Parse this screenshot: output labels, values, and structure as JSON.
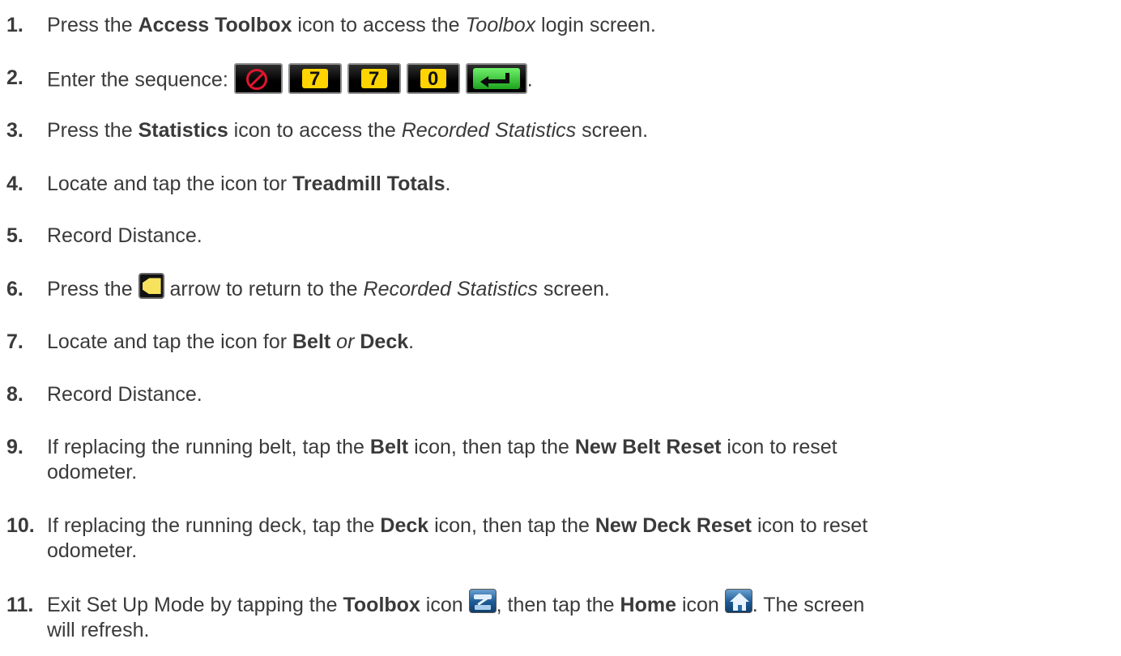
{
  "steps": [
    {
      "n": "1.",
      "t1": "Press the ",
      "b1": "Access Toolbox",
      "t2": " icon to access the ",
      "i1": "Toolbox",
      "t3": " login screen."
    },
    {
      "n": "2.",
      "t1": "Enter the sequence: ",
      "keys": {
        "cancel_icon": "cancel-icon",
        "d1": "7",
        "d2": "7",
        "d3": "0",
        "enter_icon": "enter-arrow-icon"
      },
      "t2": "."
    },
    {
      "n": "3.",
      "t1": "Press the ",
      "b1": "Statistics",
      "t2": " icon to access the ",
      "i1": "Recorded Statistics",
      "t3": " screen."
    },
    {
      "n": "4.",
      "t1": "Locate and tap the icon tor ",
      "b1": "Treadmill Totals",
      "t2": "."
    },
    {
      "n": "5.",
      "t1": "Record Distance."
    },
    {
      "n": "6.",
      "t1": "Press the ",
      "t2": " arrow to return to the ",
      "i1": "Recorded Statistics",
      "t3": " screen."
    },
    {
      "n": "7.",
      "t1": "Locate and tap the icon for ",
      "b1": "Belt",
      "i1": " or ",
      "b2": "Deck",
      "t2": "."
    },
    {
      "n": "8.",
      "t1": "Record Distance."
    },
    {
      "n": "9.",
      "t1": "If replacing the running belt, tap the ",
      "b1": "Belt",
      "t2": " icon, then tap the ",
      "b2": "New Belt Reset",
      "t3": " icon to reset",
      "t4": "odometer."
    },
    {
      "n": "10.",
      "t1": "If replacing the running deck, tap the ",
      "b1": "Deck",
      "t2": " icon, then tap the ",
      "b2": "New Deck Reset",
      "t3": " icon to reset",
      "t4": "odometer."
    },
    {
      "n": "11.",
      "t1": "Exit Set Up Mode by tapping the ",
      "b1": "Toolbox",
      "t2": " icon ",
      "t3": ", then tap the ",
      "b2": "Home",
      "t4": " icon ",
      "t5": ". The screen",
      "t6": "will refresh."
    }
  ],
  "colors": {
    "text": "#3a3a3a",
    "digit_key": "#ffd400",
    "enter_key": "#3cc93a",
    "cancel": "#e0152f",
    "back_arrow": "#f7e25e",
    "toolbox_icon": "#1d5a93"
  }
}
